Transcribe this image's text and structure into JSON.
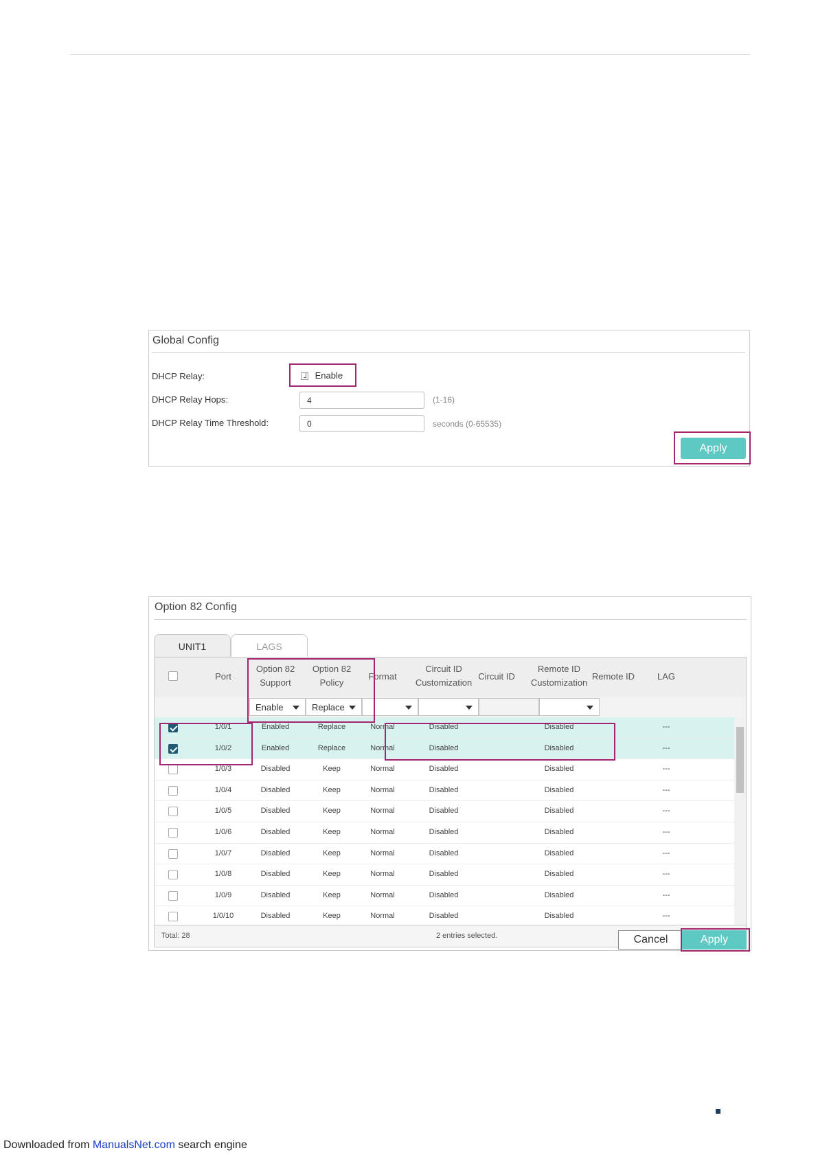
{
  "global_config": {
    "title": "Global Config",
    "dhcp_relay_label": "DHCP Relay:",
    "enable_label": "Enable",
    "enable_checked": true,
    "hops_label": "DHCP Relay Hops:",
    "hops_value": "4",
    "hops_hint": "(1-16)",
    "threshold_label": "DHCP Relay Time Threshold:",
    "threshold_value": "0",
    "threshold_hint": "seconds (0-65535)",
    "apply_label": "Apply"
  },
  "option82": {
    "title": "Option 82 Config",
    "tabs": [
      "UNIT1",
      "LAGS"
    ],
    "headers": {
      "port": "Port",
      "support_1": "Option 82",
      "support_2": "Support",
      "policy_1": "Option 82",
      "policy_2": "Policy",
      "format": "Format",
      "circuit_cust_1": "Circuit ID",
      "circuit_cust_2": "Customization",
      "circuit_id": "Circuit ID",
      "remote_cust_1": "Remote ID",
      "remote_cust_2": "Customization",
      "remote_id": "Remote ID",
      "lag": "LAG"
    },
    "filters": {
      "support": "Enable",
      "policy": "Replace",
      "format": "",
      "circuit_cust": "",
      "remote_cust": ""
    },
    "rows": [
      {
        "checked": true,
        "port": "1/0/1",
        "support": "Enabled",
        "policy": "Replace",
        "format": "Normal",
        "circuit": "Disabled",
        "remote": "Disabled",
        "lag": "---"
      },
      {
        "checked": true,
        "port": "1/0/2",
        "support": "Enabled",
        "policy": "Replace",
        "format": "Normal",
        "circuit": "Disabled",
        "remote": "Disabled",
        "lag": "---"
      },
      {
        "checked": false,
        "port": "1/0/3",
        "support": "Disabled",
        "policy": "Keep",
        "format": "Normal",
        "circuit": "Disabled",
        "remote": "Disabled",
        "lag": "---"
      },
      {
        "checked": false,
        "port": "1/0/4",
        "support": "Disabled",
        "policy": "Keep",
        "format": "Normal",
        "circuit": "Disabled",
        "remote": "Disabled",
        "lag": "---"
      },
      {
        "checked": false,
        "port": "1/0/5",
        "support": "Disabled",
        "policy": "Keep",
        "format": "Normal",
        "circuit": "Disabled",
        "remote": "Disabled",
        "lag": "---"
      },
      {
        "checked": false,
        "port": "1/0/6",
        "support": "Disabled",
        "policy": "Keep",
        "format": "Normal",
        "circuit": "Disabled",
        "remote": "Disabled",
        "lag": "---"
      },
      {
        "checked": false,
        "port": "1/0/7",
        "support": "Disabled",
        "policy": "Keep",
        "format": "Normal",
        "circuit": "Disabled",
        "remote": "Disabled",
        "lag": "---"
      },
      {
        "checked": false,
        "port": "1/0/8",
        "support": "Disabled",
        "policy": "Keep",
        "format": "Normal",
        "circuit": "Disabled",
        "remote": "Disabled",
        "lag": "---"
      },
      {
        "checked": false,
        "port": "1/0/9",
        "support": "Disabled",
        "policy": "Keep",
        "format": "Normal",
        "circuit": "Disabled",
        "remote": "Disabled",
        "lag": "---"
      },
      {
        "checked": false,
        "port": "1/0/10",
        "support": "Disabled",
        "policy": "Keep",
        "format": "Normal",
        "circuit": "Disabled",
        "remote": "Disabled",
        "lag": "---"
      }
    ],
    "total": "Total: 28",
    "selected_text": "2 entries selected.",
    "cancel_label": "Cancel",
    "apply_label": "Apply"
  },
  "source": {
    "prefix": "Downloaded from ",
    "link": "ManualsNet.com",
    "suffix": " search engine"
  },
  "colors": {
    "accent": "#5ec8c3",
    "highlight": "#a3246f",
    "selected_row": "#d8f3ef"
  }
}
